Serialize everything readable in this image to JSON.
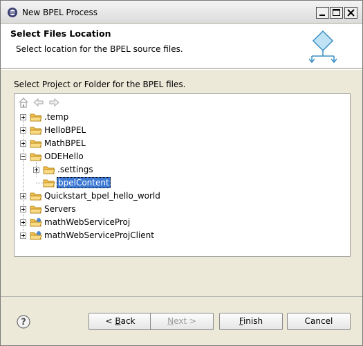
{
  "window": {
    "title": "New BPEL Process",
    "app_icon": "eclipse-icon",
    "controls": [
      "minimize-icon",
      "maximize-icon",
      "close-icon"
    ]
  },
  "banner": {
    "title": "Select Files Location",
    "description": "Select location for the BPEL source files.",
    "icon": "bpel-process-icon"
  },
  "instruction": "Select Project or Folder for the BPEL files.",
  "toolbar": {
    "icons": [
      "home-icon",
      "back-arrow-icon",
      "forward-arrow-icon"
    ]
  },
  "tree": {
    "items": [
      {
        "label": ".temp",
        "expander": "plus",
        "level": 0
      },
      {
        "label": "HelloBPEL",
        "expander": "plus",
        "level": 0
      },
      {
        "label": "MathBPEL",
        "expander": "plus",
        "level": 0
      },
      {
        "label": "ODEHello",
        "expander": "minus",
        "level": 0
      },
      {
        "label": ".settings",
        "expander": "plus",
        "level": 1
      },
      {
        "label": "bpelContent",
        "expander": "none",
        "level": 1,
        "selected": true
      },
      {
        "label": "Quickstart_bpel_hello_world",
        "expander": "plus",
        "level": 0
      },
      {
        "label": "Servers",
        "expander": "plus",
        "level": 0
      },
      {
        "label": "mathWebServiceProj",
        "expander": "plus",
        "level": 0
      },
      {
        "label": "mathWebServiceProjClient",
        "expander": "plus",
        "level": 0
      }
    ]
  },
  "buttons": {
    "back": {
      "mnemonic": "B",
      "rest": "ack",
      "prefix": "< "
    },
    "next": {
      "mnemonic": "N",
      "rest": "ext >",
      "prefix": ""
    },
    "finish": {
      "mnemonic": "F",
      "rest": "inish",
      "prefix": ""
    },
    "cancel": "Cancel"
  },
  "help_icon": "help-icon",
  "colors": {
    "selection": "#3a78d4",
    "folder": "#f2c14e"
  }
}
